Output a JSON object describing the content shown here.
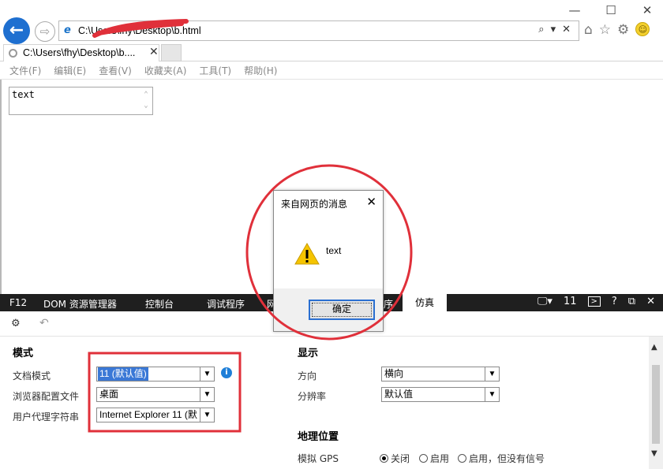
{
  "window": {
    "controls": [
      "—",
      "☐",
      "✕"
    ]
  },
  "navigation": {
    "back_icon": "back-arrow-icon",
    "forward_icon": "forward-arrow-icon",
    "address": "C:\\Users\\fhy\\Desktop\\b.html",
    "address_tools": [
      "⌕",
      "▾",
      "✕"
    ],
    "right_icons": [
      "⌂",
      "☆",
      "⚙"
    ]
  },
  "tab": {
    "label": "C:\\Users\\fhy\\Desktop\\b....",
    "close": "✕"
  },
  "menu": {
    "items": [
      "文件(F)",
      "编辑(E)",
      "查看(V)",
      "收藏夹(A)",
      "工具(T)",
      "帮助(H)"
    ]
  },
  "page": {
    "textarea_value": "text"
  },
  "devtools": {
    "tabs": {
      "f12": "F12",
      "dom": "DOM 资源管理器",
      "console": "控制台",
      "debugger": "调试程序",
      "network_partial": "网",
      "perf_partial": "序",
      "emulation": "仿真"
    },
    "right": {
      "version": "11",
      "help": "?",
      "close": "✕"
    },
    "mode": {
      "title": "模式",
      "document_mode_label": "文档模式",
      "document_mode_value": "11 (默认值)",
      "browser_profile_label": "浏览器配置文件",
      "browser_profile_value": "桌面",
      "user_agent_label": "用户代理字符串",
      "user_agent_value": "Internet Explorer 11 (默"
    },
    "display": {
      "title": "显示",
      "orientation_label": "方向",
      "orientation_value": "横向",
      "resolution_label": "分辨率",
      "resolution_value": "默认值"
    },
    "geolocation": {
      "title": "地理位置",
      "gps_label": "模拟 GPS",
      "options": [
        "关闭",
        "启用",
        "启用，但没有信号"
      ],
      "selected_index": 0
    }
  },
  "alert": {
    "title": "来自网页的消息",
    "message": "text",
    "ok_label": "确定"
  },
  "colors": {
    "accent_blue": "#1e6fd0",
    "devtools_tab_bg": "#1f1f1f",
    "annotation_red": "#e0303a"
  }
}
